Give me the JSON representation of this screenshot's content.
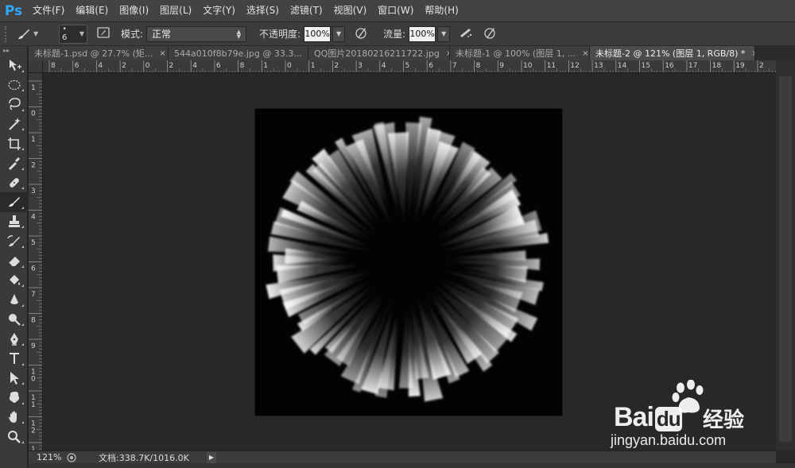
{
  "app": {
    "logo": "Ps"
  },
  "menu": [
    "文件(F)",
    "编辑(E)",
    "图像(I)",
    "图层(L)",
    "文字(Y)",
    "选择(S)",
    "滤镜(T)",
    "视图(V)",
    "窗口(W)",
    "帮助(H)"
  ],
  "options": {
    "brush_size": "6",
    "mode_label": "模式:",
    "mode_value": "正常",
    "opacity_label": "不透明度:",
    "opacity_value": "100%",
    "flow_label": "流量:",
    "flow_value": "100%"
  },
  "tabs": [
    {
      "label": "未标题-1.psd @ 27.7% (矩...",
      "close": "×",
      "active": false
    },
    {
      "label": "544a010f8b79e.jpg @ 33.3...",
      "close": "×",
      "active": false
    },
    {
      "label": "QQ图片20180216211722.jpg",
      "close": "×",
      "active": false
    },
    {
      "label": "未标题-1 @ 100% (图层 1, ...",
      "close": "×",
      "active": false
    },
    {
      "label": "未标题-2 @ 121% (图层 1, RGB/8) *",
      "close": "×",
      "active": true
    }
  ],
  "ruler_h_labels": [
    "8",
    "6",
    "4",
    "2",
    "0",
    "2",
    "4",
    "6",
    "8",
    "1",
    "0",
    "1",
    "2",
    "3",
    "4",
    "5",
    "6",
    "7",
    "8",
    "9",
    "10",
    "11",
    "12",
    "13",
    "14",
    "15",
    "16",
    "17",
    "18",
    "19",
    "2"
  ],
  "ruler_v_labels": [
    "1",
    "0",
    "1",
    "2",
    "3",
    "4",
    "5",
    "6",
    "7",
    "8",
    "9",
    "1\n0",
    "1\n1",
    "1\n2",
    "1\n3"
  ],
  "tools": [
    {
      "name": "move-tool-icon",
      "active": false
    },
    {
      "name": "elliptical-marquee-tool-icon",
      "active": false
    },
    {
      "name": "lasso-tool-icon",
      "active": false
    },
    {
      "name": "magic-wand-tool-icon",
      "active": false
    },
    {
      "name": "crop-tool-icon",
      "active": false
    },
    {
      "name": "eyedropper-tool-icon",
      "active": false
    },
    {
      "name": "healing-brush-tool-icon",
      "active": false
    },
    {
      "name": "brush-tool-icon",
      "active": true
    },
    {
      "name": "clone-stamp-tool-icon",
      "active": false
    },
    {
      "name": "history-brush-tool-icon",
      "active": false
    },
    {
      "name": "eraser-tool-icon",
      "active": false
    },
    {
      "name": "paint-bucket-tool-icon",
      "active": false
    },
    {
      "name": "blur-tool-icon",
      "active": false
    },
    {
      "name": "dodge-tool-icon",
      "active": false
    },
    {
      "name": "pen-tool-icon",
      "active": false
    },
    {
      "name": "type-tool-icon",
      "active": false
    },
    {
      "name": "path-selection-tool-icon",
      "active": false
    },
    {
      "name": "custom-shape-tool-icon",
      "active": false
    },
    {
      "name": "hand-tool-icon",
      "active": false
    },
    {
      "name": "zoom-tool-icon",
      "active": false
    }
  ],
  "status": {
    "zoom": "121%",
    "doc_info": "文档:338.7K/1016.0K"
  },
  "watermark": {
    "brand": "Bai",
    "brand2": "du",
    "cn": "经验",
    "url": "jingyan.baidu.com"
  },
  "colors": {
    "accent": "#31a8ff",
    "canvas_bg": "#030303",
    "workspace_bg": "#282828",
    "panel_bg": "#3a3a3a"
  }
}
